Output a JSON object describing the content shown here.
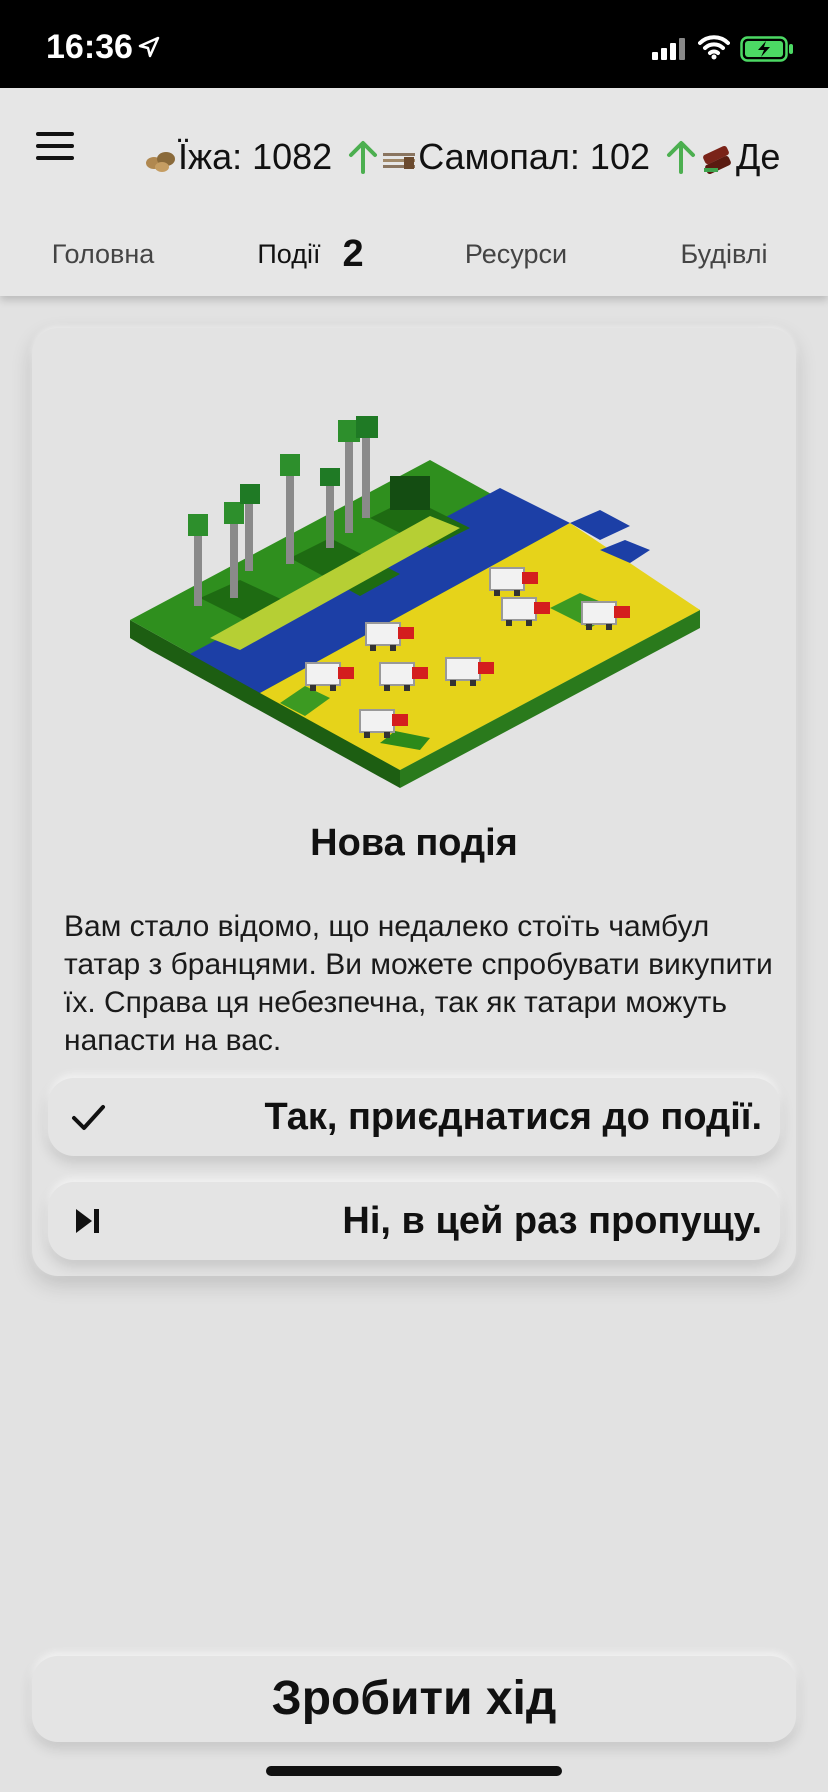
{
  "status_bar": {
    "time": "16:36",
    "icons": [
      "location-arrow-icon",
      "cellular-signal-icon",
      "wifi-icon",
      "battery-charging-icon"
    ],
    "battery_color": "#4cd964"
  },
  "header": {
    "menu_icon": "hamburger-menu-icon",
    "resources": [
      {
        "icon": "food-icon",
        "text": "Їжа: 1082",
        "trend": "up"
      },
      {
        "icon": "musket-icon",
        "text": "Самопал: 102",
        "trend": "up"
      },
      {
        "icon": "wood-icon",
        "text": "Де",
        "trend": ""
      }
    ],
    "trend_up_color": "#4caf50"
  },
  "tabs": [
    {
      "label": "Головна"
    },
    {
      "label": "Події",
      "badge": "2",
      "active": true
    },
    {
      "label": "Ресурси"
    },
    {
      "label": "Будівлі"
    }
  ],
  "event": {
    "illustration": "voxel-river-camp-with-carts-illustration",
    "title": "Нова подія",
    "text": "Вам стало відомо, що недалеко стоїть чамбул татар з бранцями. Ви можете спробувати викупити їх. Справа ця небезпечна, так як татари можуть напасти на вас.",
    "choices": [
      {
        "icon": "checkmark-icon",
        "label": "Так, приєднатися до події."
      },
      {
        "icon": "skip-next-icon",
        "label": "Ні, в цей раз пропущу."
      }
    ]
  },
  "footer": {
    "turn_button_label": "Зробити хід"
  }
}
